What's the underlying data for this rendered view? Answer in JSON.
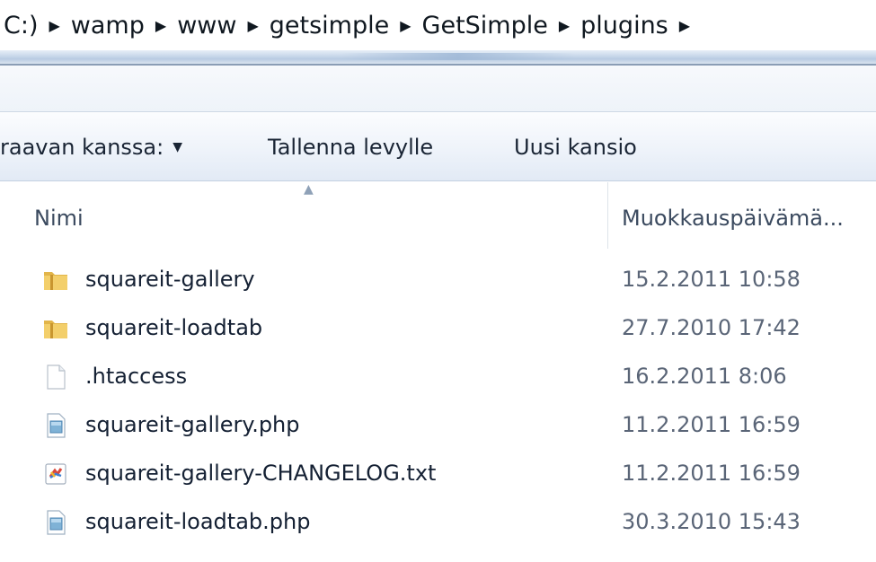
{
  "address_bar": {
    "crumbs": [
      "C:)",
      "wamp",
      "www",
      "getsimple",
      "GetSimple",
      "plugins"
    ]
  },
  "toolbar": {
    "share_label": "raavan kanssa:",
    "save_label": "Tallenna levylle",
    "new_folder_label": "Uusi kansio"
  },
  "columns": {
    "name": "Nimi",
    "modified": "Muokkauspäivämä..."
  },
  "files": [
    {
      "name": "squareit-gallery",
      "modified": "15.2.2011 10:58",
      "icon": "folder-icon"
    },
    {
      "name": "squareit-loadtab",
      "modified": "27.7.2010 17:42",
      "icon": "folder-icon"
    },
    {
      "name": ".htaccess",
      "modified": "16.2.2011 8:06",
      "icon": "blank-file-icon"
    },
    {
      "name": "squareit-gallery.php",
      "modified": "11.2.2011 16:59",
      "icon": "php-file-icon"
    },
    {
      "name": "squareit-gallery-CHANGELOG.txt",
      "modified": "11.2.2011 16:59",
      "icon": "text-file-icon"
    },
    {
      "name": "squareit-loadtab.php",
      "modified": "30.3.2010 15:43",
      "icon": "php-file-icon"
    }
  ]
}
